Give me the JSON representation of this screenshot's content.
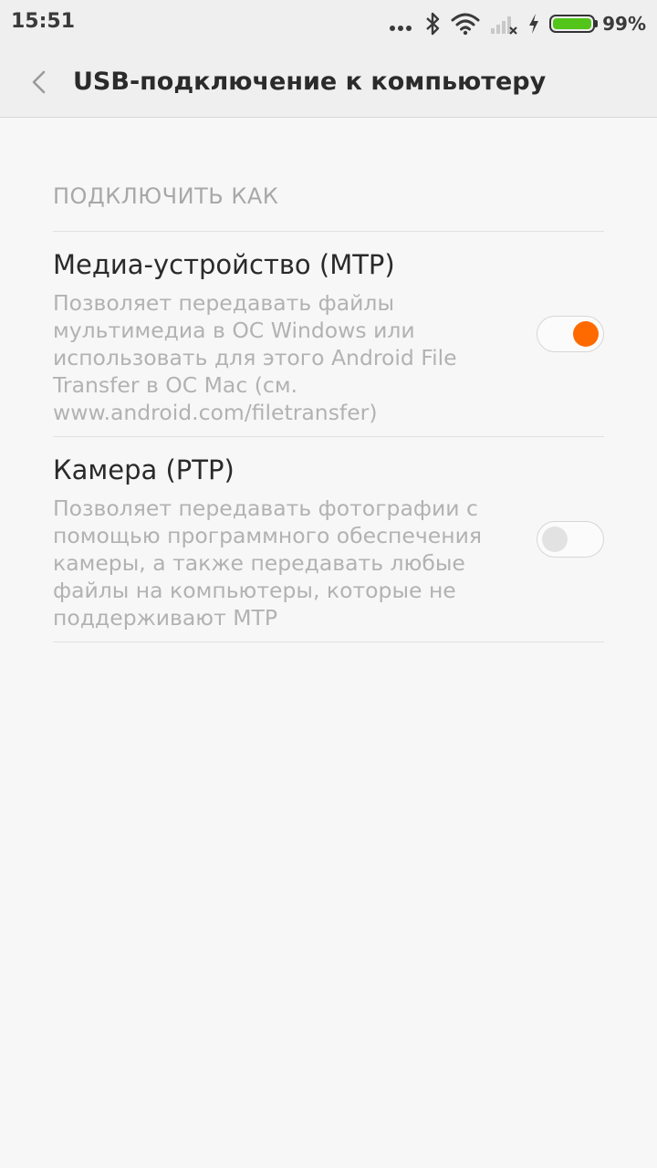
{
  "status_bar": {
    "time": "15:51",
    "icons": [
      "more-dots-icon",
      "bluetooth-icon",
      "wifi-icon",
      "signal-no-sim-icon",
      "charging-bolt-icon",
      "battery-icon"
    ],
    "battery_percent": "99%",
    "battery_level": 0.99,
    "battery_color": "#52c41a"
  },
  "title_bar": {
    "back_icon": "chevron-left-icon",
    "title": "USB-подключение к компьютеру"
  },
  "section": {
    "header": "ПОДКЛЮЧИТЬ КАК",
    "items": [
      {
        "title": "Медиа-устройство (MTP)",
        "description_lines": [
          "Позволяет передавать файлы",
          "мультимедиа в ОС Windows или",
          "использовать для этого Android File",
          "Transfer в ОС Mac (см.",
          "www.android.com/filetransfer)"
        ],
        "enabled": true
      },
      {
        "title": "Камера (PTP)",
        "description_lines": [
          "Позволяет передавать фотографии с",
          "помощью программного обеспечения",
          "камеры, а также передавать любые",
          "файлы на компьютеры, которые не",
          "поддерживают MTP"
        ],
        "enabled": false
      }
    ]
  },
  "colors": {
    "accent": "#ff6a00",
    "background": "#f7f7f7",
    "header_bg": "#efefef",
    "secondary_text": "#b2b2b2"
  }
}
